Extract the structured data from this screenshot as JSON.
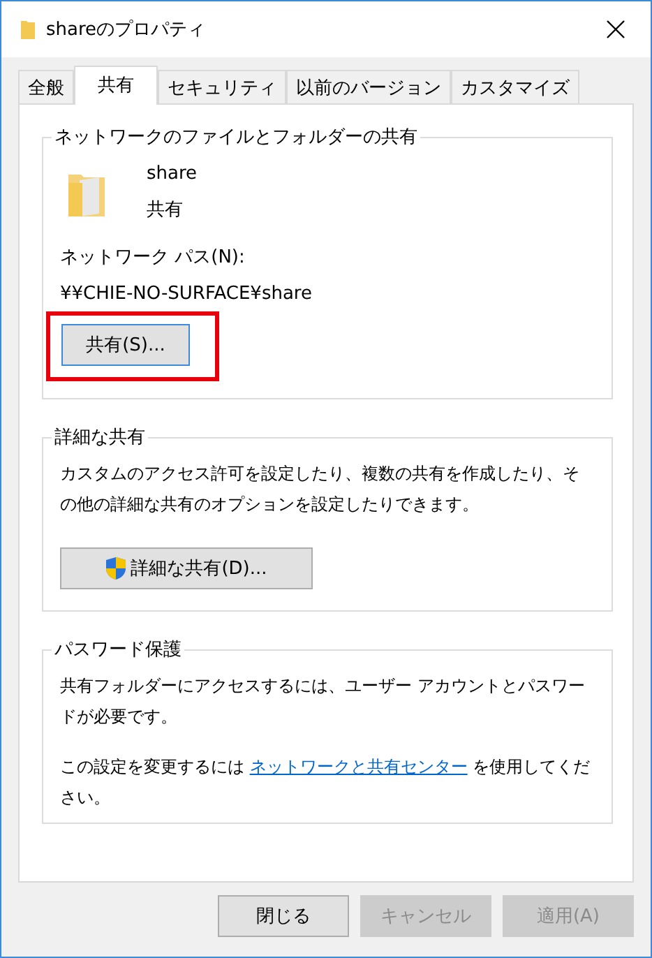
{
  "window": {
    "title": "shareのプロパティ"
  },
  "tabs": [
    {
      "label": "全般",
      "selected": false
    },
    {
      "label": "共有",
      "selected": true
    },
    {
      "label": "セキュリティ",
      "selected": false
    },
    {
      "label": "以前のバージョン",
      "selected": false
    },
    {
      "label": "カスタマイズ",
      "selected": false
    }
  ],
  "network_sharing": {
    "title": "ネットワークのファイルとフォルダーの共有",
    "folder_name": "share",
    "folder_status": "共有",
    "path_label": "ネットワーク パス(N):",
    "path": "¥¥CHIE-NO-SURFACE¥share",
    "share_button": {
      "label": "共有(S)...",
      "highlighted": true
    }
  },
  "advanced_sharing": {
    "title": "詳細な共有",
    "description": "カスタムのアクセス許可を設定したり、複数の共有を作成したり、その他の詳細な共有のオプションを設定したりできます。",
    "button": "詳細な共有(D)..."
  },
  "password_protection": {
    "title": "パスワード保護",
    "description": "共有フォルダーにアクセスするには、ユーザー アカウントとパスワードが必要です。",
    "note_before": "この設定を変更するには ",
    "link": "ネットワークと共有センター",
    "note_after": " を使用してください。"
  },
  "buttons": [
    {
      "label": "閉じる",
      "disabled": false
    },
    {
      "label": "キャンセル",
      "disabled": true
    },
    {
      "label": "適用(A)",
      "disabled": true
    }
  ]
}
